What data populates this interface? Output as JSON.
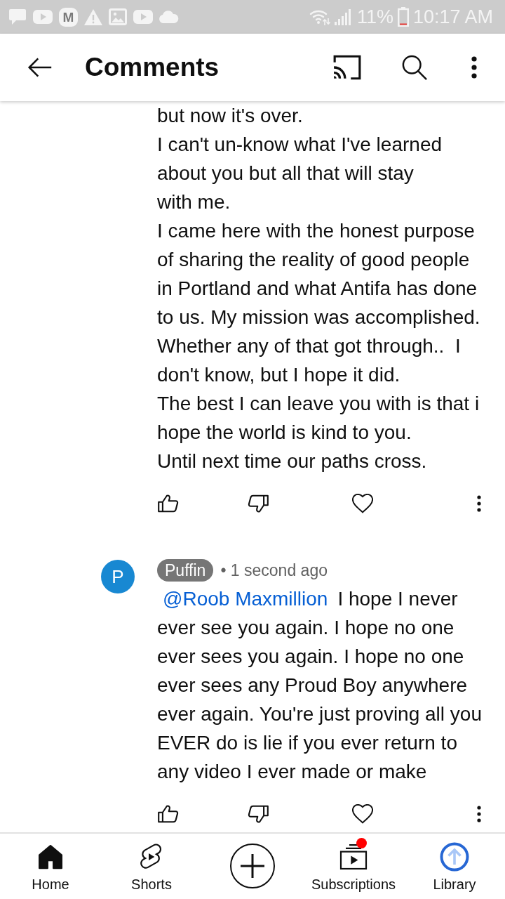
{
  "status_bar": {
    "app_letter": "M",
    "battery": "11%",
    "time": "10:17 AM"
  },
  "app_bar": {
    "title": "Comments"
  },
  "comments": [
    {
      "segments": [
        {
          "kind": "plain",
          "text": "but now it's over.\nI can't un-know what I've learned\nabout you but all that will stay\nwith me.\nI came here with the honest purpose\nof sharing the reality of good people\nin Portland and what Antifa has done\nto us. My mission was accomplished.\nWhether any of that got through..  I\ndon't know, but I hope it did.\nThe best I can leave you with is that i\nhope the world is kind to you.\nUntil next time our paths cross."
        }
      ]
    },
    {
      "avatar": "P",
      "author": "Puffin",
      "creator": true,
      "meta": "• 1 second ago",
      "segments": [
        {
          "kind": "mention",
          "text": "@Roob Maxmillion"
        },
        {
          "kind": "plain",
          "text": "I hope I never\never see you again. I hope no one\never sees you again. I hope no one\never sees any Proud Boy anywhere\never again. You're just proving all you\nEVER do is lie if you ever return to\nany video I ever made or make"
        }
      ]
    }
  ],
  "bottom_nav": {
    "items": [
      {
        "kind": "tab",
        "label": "Home",
        "selected": true
      },
      {
        "kind": "tab",
        "label": "Shorts",
        "selected": false
      },
      {
        "kind": "create"
      },
      {
        "kind": "tab",
        "label": "Subscriptions",
        "selected": false,
        "new_content": true
      },
      {
        "kind": "tab",
        "label": "Library",
        "selected": false
      }
    ]
  }
}
